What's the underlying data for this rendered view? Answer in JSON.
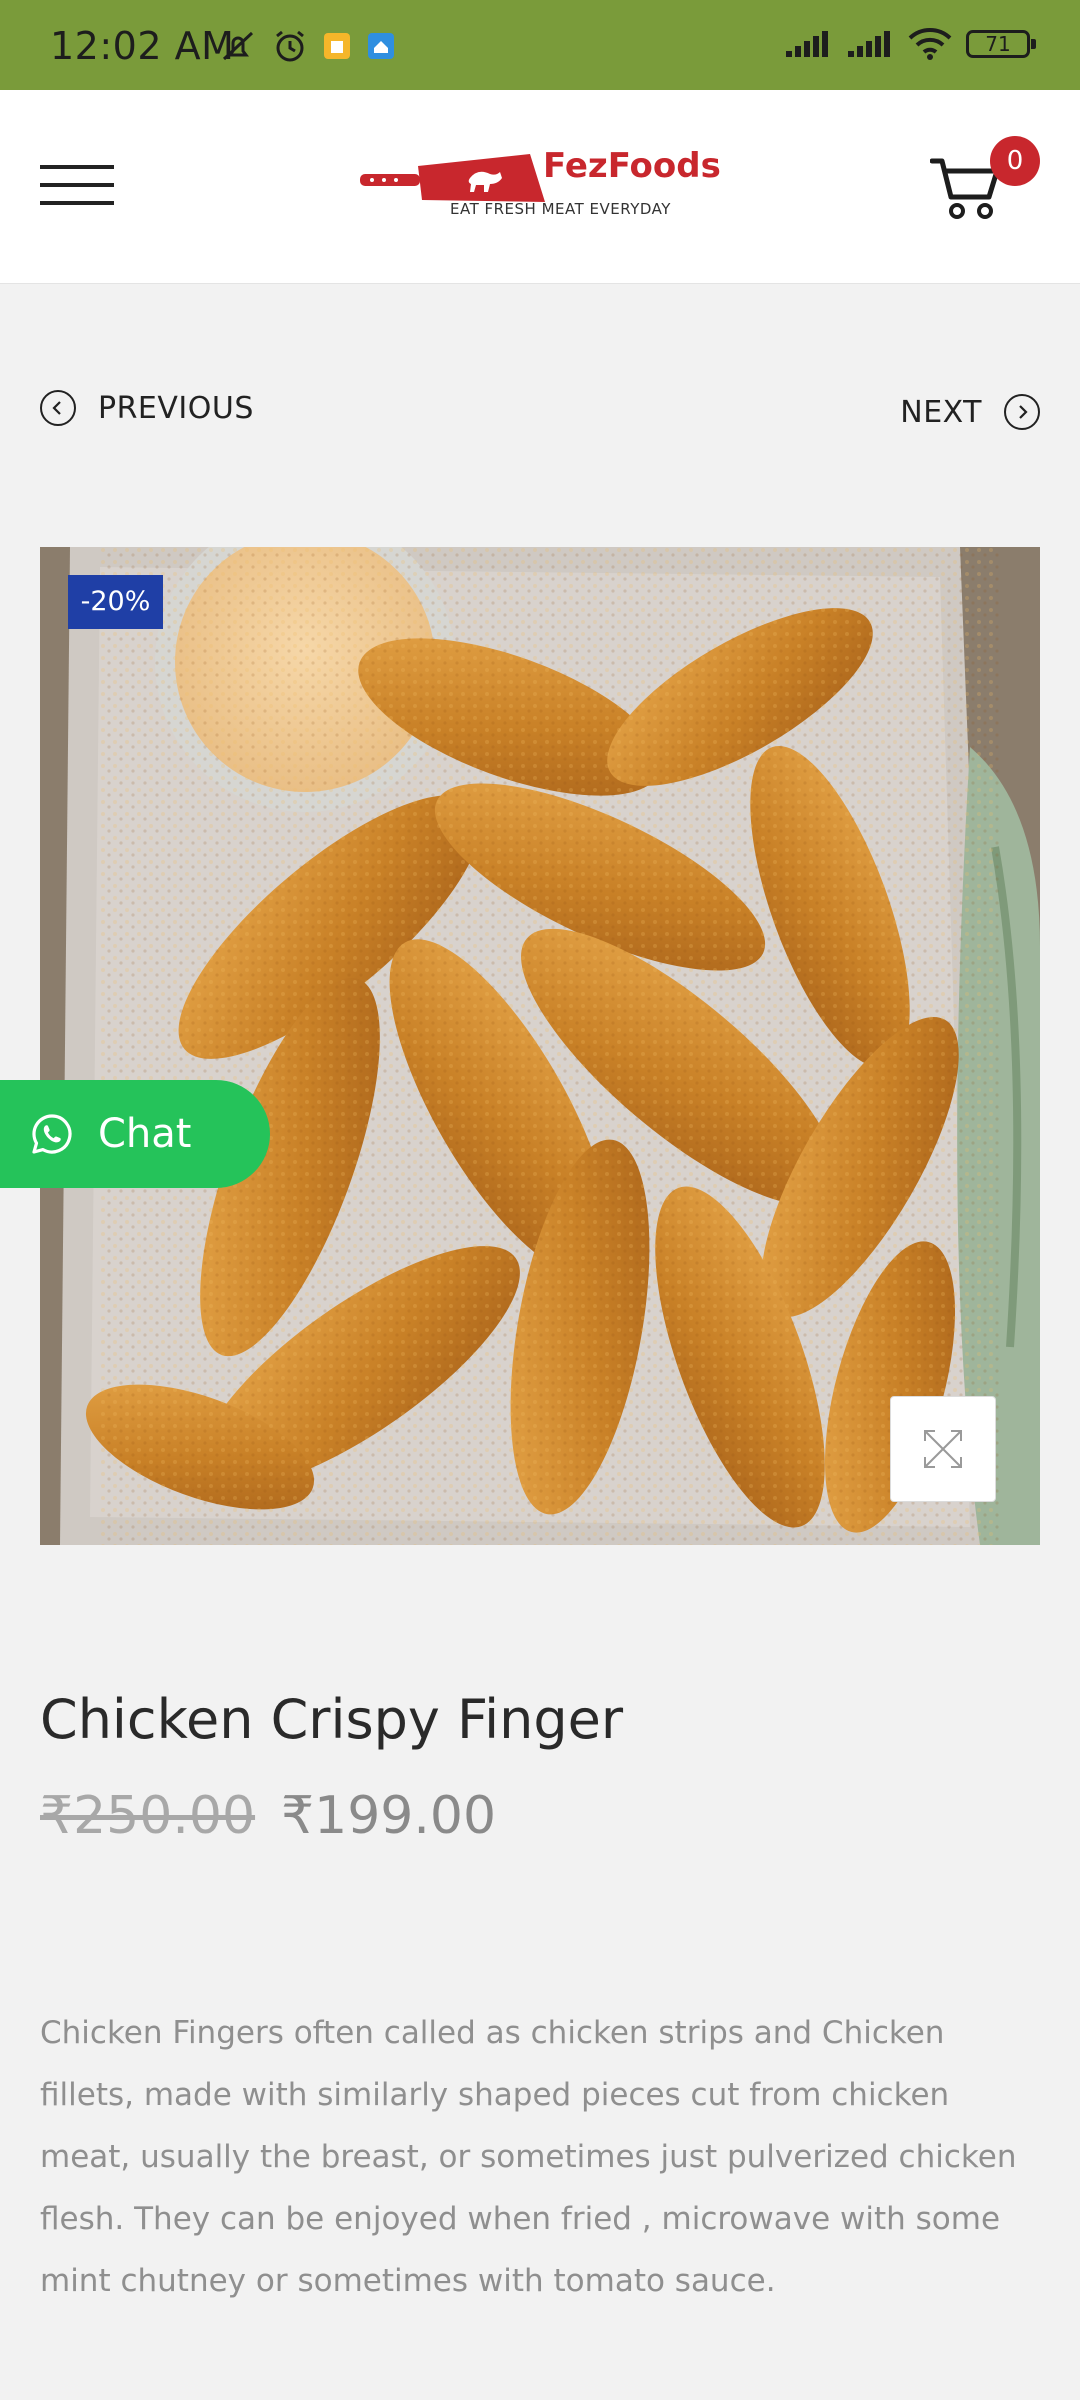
{
  "status_bar": {
    "time": "12:02 AM",
    "battery": "71"
  },
  "header": {
    "logo_name": "FezFoods",
    "logo_tagline": "EAT FRESH MEAT EVERYDAY",
    "cart_count": "0"
  },
  "nav": {
    "previous_label": "PREVIOUS",
    "next_label": "NEXT"
  },
  "product": {
    "discount_badge": "-20%",
    "title": "Chicken Crispy Finger",
    "old_price": "₹250.00",
    "new_price": "₹199.00",
    "description": "Chicken Fingers often called as chicken strips and Chicken fillets, made with similarly shaped pieces cut from chicken meat, usually the breast, or sometimes just pulverized chicken flesh. They can be enjoyed when fried , microwave with some mint chutney or sometimes with tomato sauce."
  },
  "chat": {
    "label": "Chat"
  },
  "colors": {
    "status_bar": "#7a9b3a",
    "brand_red": "#c8272d",
    "badge_blue": "#1f3fa6",
    "chat_green": "#25c35a"
  },
  "icons": {
    "menu": "hamburger-icon",
    "cart": "cart-icon",
    "previous": "chevron-left-icon",
    "next": "chevron-right-icon",
    "zoom": "expand-icon",
    "chat": "whatsapp-icon"
  }
}
